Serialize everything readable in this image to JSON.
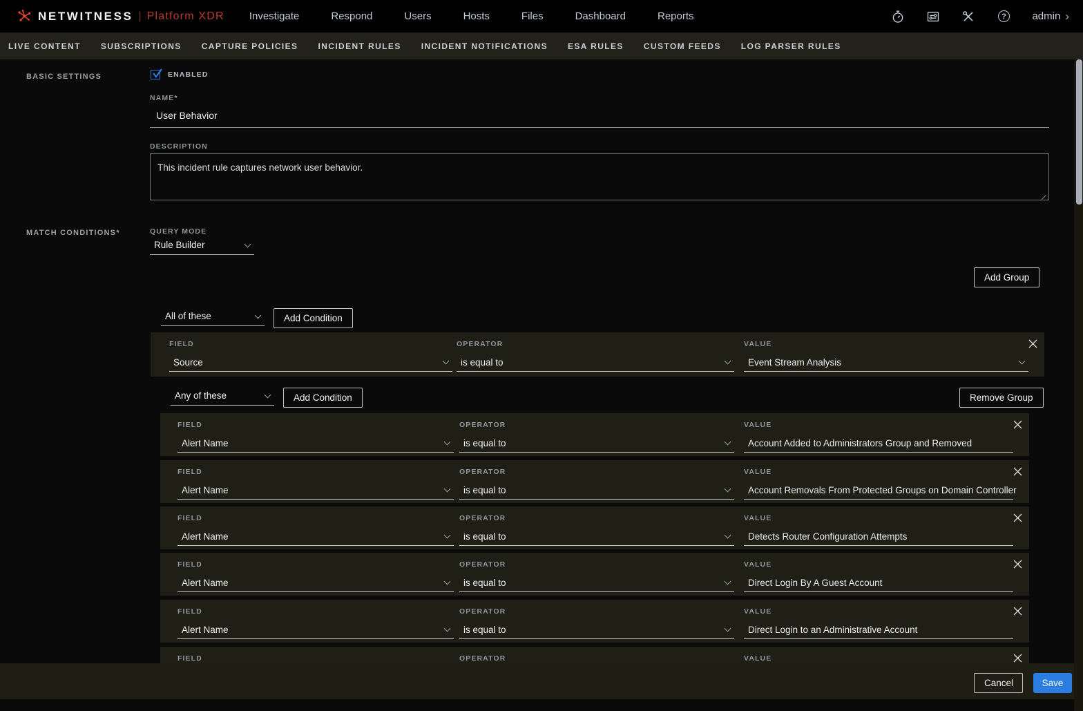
{
  "topnav": {
    "brand": "NETWITNESS",
    "brand_divider": "|",
    "brand_suffix": "Platform XDR",
    "items": [
      "Investigate",
      "Respond",
      "Users",
      "Hosts",
      "Files",
      "Dashboard",
      "Reports"
    ],
    "icons": [
      "timer-icon",
      "jobs-icon",
      "admin-tools-icon",
      "help-icon"
    ],
    "help_glyph": "?",
    "user_menu": "admin",
    "user_menu_chevron": "›"
  },
  "subnav": {
    "items": [
      "LIVE CONTENT",
      "SUBSCRIPTIONS",
      "CAPTURE POLICIES",
      "INCIDENT RULES",
      "INCIDENT NOTIFICATIONS",
      "ESA RULES",
      "CUSTOM FEEDS",
      "LOG PARSER RULES"
    ]
  },
  "basic_settings": {
    "section_label": "BASIC SETTINGS",
    "enabled_label": "ENABLED",
    "enabled_checked": true,
    "name_label": "NAME*",
    "name_value": "User Behavior",
    "description_label": "DESCRIPTION",
    "description_value": "This incident rule captures network user behavior."
  },
  "match_conditions": {
    "section_label": "MATCH CONDITIONS*",
    "query_mode_label": "QUERY MODE",
    "query_mode_value": "Rule Builder",
    "add_group_label": "Add Group",
    "add_condition_label": "Add Condition",
    "remove_group_label": "Remove Group",
    "field_label": "FIELD",
    "operator_label": "OPERATOR",
    "value_label": "VALUE",
    "groups": [
      {
        "match": "All of these",
        "conditions": [
          {
            "field": "Source",
            "operator": "is equal to",
            "value": "Event Stream Analysis"
          }
        ]
      },
      {
        "match": "Any of these",
        "conditions": [
          {
            "field": "Alert Name",
            "operator": "is equal to",
            "value": "Account Added to Administrators Group and Removed"
          },
          {
            "field": "Alert Name",
            "operator": "is equal to",
            "value": "Account Removals From Protected Groups on Domain Controller"
          },
          {
            "field": "Alert Name",
            "operator": "is equal to",
            "value": "Detects Router Configuration Attempts"
          },
          {
            "field": "Alert Name",
            "operator": "is equal to",
            "value": "Direct Login By A Guest Account"
          },
          {
            "field": "Alert Name",
            "operator": "is equal to",
            "value": "Direct Login to an Administrative Account"
          },
          {
            "field": "",
            "operator": "",
            "value": ""
          }
        ]
      }
    ]
  },
  "footer": {
    "cancel_label": "Cancel",
    "save_label": "Save"
  },
  "colors": {
    "accent_red": "#d6452c",
    "brand_text_red": "#b33d2b",
    "save_blue": "#2b7de2",
    "checkbox_blue": "#2a7ae0",
    "row_bg": "#201f16",
    "subnav_bg": "#23221a"
  }
}
